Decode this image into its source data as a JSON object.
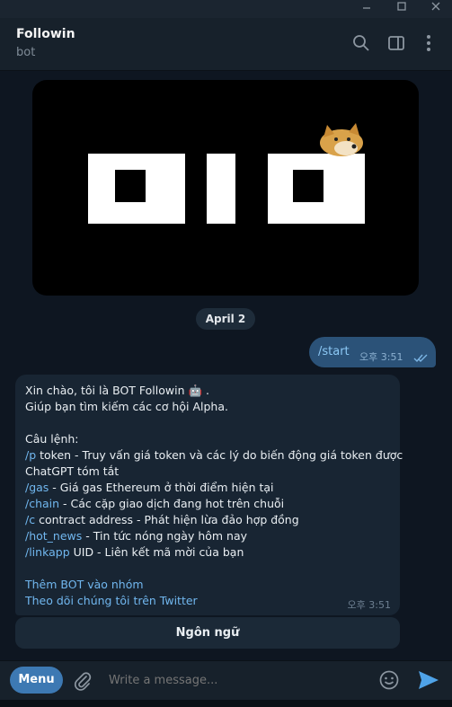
{
  "window": {
    "minimize_icon": "minimize-icon",
    "maximize_icon": "maximize-icon",
    "close_icon": "close-icon"
  },
  "header": {
    "title": "Followin",
    "subtitle": "bot",
    "icons": [
      "search-icon",
      "sidebar-toggle-icon",
      "more-vert-icon"
    ]
  },
  "media": {
    "logo_alt": "OIO logo with doge"
  },
  "date_badge": "April 2",
  "outgoing": {
    "text": "/start",
    "time": "오후 3:51",
    "status": "read"
  },
  "incoming": {
    "greeting": "Xin chào, tôi là BOT Followin 🤖 .",
    "intro": "Giúp bạn tìm kiếm các cơ hội Alpha.",
    "commands_header": "Câu lệnh:",
    "commands": [
      {
        "cmd": "/p",
        "desc": " token - Truy vấn giá token và các lý do biến động giá token được"
      },
      {
        "cmd": "",
        "desc": "ChatGPT tóm tắt"
      },
      {
        "cmd": "/gas",
        "desc": " - Giá gas Ethereum ở thời điểm hiện tại"
      },
      {
        "cmd": "/chain",
        "desc": " - Các cặp giao dịch đang hot trên chuỗi"
      },
      {
        "cmd": "/c",
        "desc": " contract address - Phát hiện lừa đảo hợp đồng"
      },
      {
        "cmd": "/hot_news",
        "desc": " - Tin tức nóng ngày hôm nay"
      },
      {
        "cmd": "/linkapp",
        "desc": " UID - Liên kết mã mời của bạn"
      }
    ],
    "link1": "Thêm BOT vào nhóm",
    "link2": "Theo dõi chúng tôi trên Twitter",
    "time": "오후 3:51"
  },
  "keyboard_button": "Ngôn ngữ",
  "composer": {
    "menu_label": "Menu",
    "placeholder": "Write a message...",
    "icons": [
      "attach-icon",
      "emoji-icon",
      "send-icon"
    ]
  },
  "colors": {
    "accent": "#3d79b3",
    "link": "#71b7ef",
    "bg": "#0e1621",
    "bubble_in": "#182533",
    "bubble_out": "#2b5278"
  }
}
